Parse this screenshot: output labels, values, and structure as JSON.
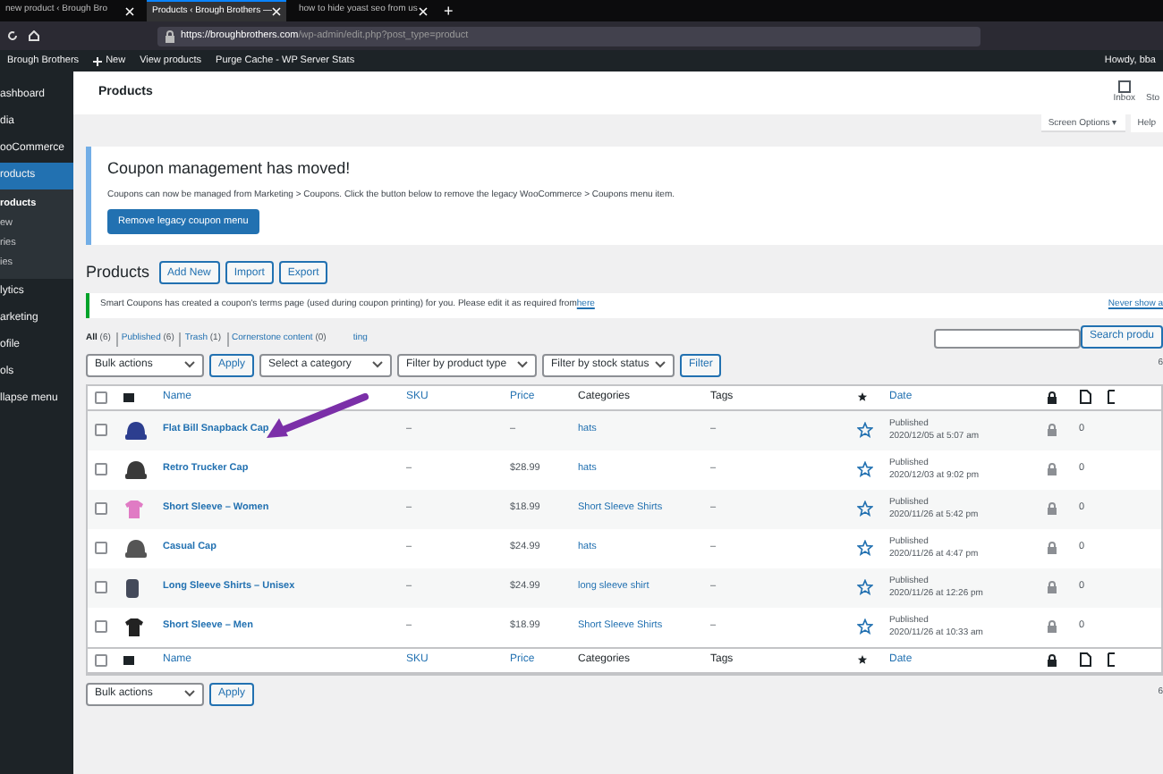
{
  "browser": {
    "tabs": [
      {
        "label": "new product ‹ Brough Bro",
        "selected": false
      },
      {
        "label": "Products ‹ Brough Brothers —",
        "selected": true
      },
      {
        "label": "how to hide yoast seo from us",
        "selected": false
      }
    ],
    "new_tab": "+",
    "url_host": "https://broughbrothers.com",
    "url_path": "/wp-admin/edit.php?post_type=product"
  },
  "admin_bar": {
    "site": "Brough Brothers",
    "new": "New",
    "items": [
      "View products",
      "Purge Cache - WP Server Stats"
    ],
    "howdy": "Howdy, bba"
  },
  "sidebar": {
    "items": [
      {
        "label": "ashboard",
        "selected": false
      },
      {
        "label": "dia",
        "selected": false
      },
      {
        "label": "ooCommerce",
        "selected": false
      },
      {
        "label": "roducts",
        "selected": true,
        "children": [
          {
            "label": "roducts",
            "selected": true
          },
          {
            "label": "ew",
            "selected": false
          },
          {
            "label": "ries",
            "selected": false
          },
          {
            "label": "ies",
            "selected": false
          }
        ]
      },
      {
        "label": "lytics",
        "selected": false
      },
      {
        "label": "arketing",
        "selected": false
      },
      {
        "label": "ofile",
        "selected": false
      },
      {
        "label": "ols",
        "selected": false
      },
      {
        "label": "llapse menu",
        "selected": false
      }
    ]
  },
  "header": {
    "title": "Products",
    "inbox": "Inbox",
    "store": "Sto",
    "screen_options": "Screen Options ▾",
    "help": "Help"
  },
  "notice": {
    "title": "Coupon management has moved!",
    "text": "Coupons can now be managed from Marketing > Coupons. Click the button below to remove the legacy WooCommerce > Coupons menu item.",
    "button": "Remove legacy coupon menu"
  },
  "page": {
    "title": "Products",
    "actions": [
      "Add New",
      "Import",
      "Export"
    ]
  },
  "smart_notice": {
    "text": "Smart Coupons has created a coupon's terms page (used during coupon printing) for you. Please edit it as required from ",
    "link": "here",
    "dismiss": "Never show a"
  },
  "views": [
    {
      "label": "All",
      "count": "(6)",
      "selected": true
    },
    {
      "label": "Published",
      "count": "(6)",
      "selected": false
    },
    {
      "label": "Trash",
      "count": "(1)",
      "selected": false
    },
    {
      "label": "Cornerstone content",
      "count": "(0)",
      "selected": false
    },
    {
      "label": "ting",
      "selected": false
    }
  ],
  "search": {
    "button": "Search produ"
  },
  "filters": {
    "bulk": "Bulk actions",
    "apply": "Apply",
    "category": "Select a category",
    "type": "Filter by product type",
    "stock": "Filter by stock status",
    "filter": "Filter"
  },
  "items_count": "6",
  "table": {
    "select_all_checked": false,
    "columns": {
      "name": "Name",
      "sku": "SKU",
      "price": "Price",
      "categories": "Categories",
      "tags": "Tags",
      "date": "Date"
    },
    "footer_select_all_checked": false,
    "footer_columns": {
      "name": "Name",
      "sku": "SKU",
      "price": "Price",
      "categories": "Categories",
      "tags": "Tags",
      "date": "Date"
    },
    "rows": [
      {
        "checked": false,
        "name": "Flat Bill Snapback Cap",
        "sku": "–",
        "price": "–",
        "category": "hats",
        "tags": "–",
        "status": "Published",
        "date": "2020/12/05 at 5:07 am",
        "count": "0",
        "thumb": {
          "kind": "cap",
          "color": "#2c3e8f"
        }
      },
      {
        "checked": false,
        "name": "Retro Trucker Cap",
        "sku": "–",
        "price": "$28.99",
        "category": "hats",
        "tags": "–",
        "status": "Published",
        "date": "2020/12/03 at 9:02 pm",
        "count": "0",
        "thumb": {
          "kind": "cap",
          "color": "#3a3a3a"
        }
      },
      {
        "checked": false,
        "name": "Short Sleeve – Women",
        "sku": "–",
        "price": "$18.99",
        "category": "Short Sleeve Shirts",
        "tags": "–",
        "status": "Published",
        "date": "2020/11/26 at 5:42 pm",
        "count": "0",
        "thumb": {
          "kind": "shirt",
          "color": "#e07bc4"
        }
      },
      {
        "checked": false,
        "name": "Casual Cap",
        "sku": "–",
        "price": "$24.99",
        "category": "hats",
        "tags": "–",
        "status": "Published",
        "date": "2020/11/26 at 4:47 pm",
        "count": "0",
        "thumb": {
          "kind": "cap",
          "color": "#555555"
        }
      },
      {
        "checked": false,
        "name": "Long Sleeve Shirts – Unisex",
        "sku": "–",
        "price": "$24.99",
        "category": "long sleeve shirt",
        "tags": "–",
        "status": "Published",
        "date": "2020/11/26 at 12:26 pm",
        "count": "0",
        "thumb": {
          "kind": "longsleeve",
          "color": "#444a5a"
        }
      },
      {
        "checked": false,
        "name": "Short Sleeve – Men",
        "sku": "–",
        "price": "$18.99",
        "category": "Short Sleeve Shirts",
        "tags": "–",
        "status": "Published",
        "date": "2020/11/26 at 10:33 am",
        "count": "0",
        "thumb": {
          "kind": "shirt",
          "color": "#222222"
        }
      }
    ]
  },
  "bottom": {
    "bulk": "Bulk actions",
    "apply": "Apply",
    "items_count": "6"
  }
}
